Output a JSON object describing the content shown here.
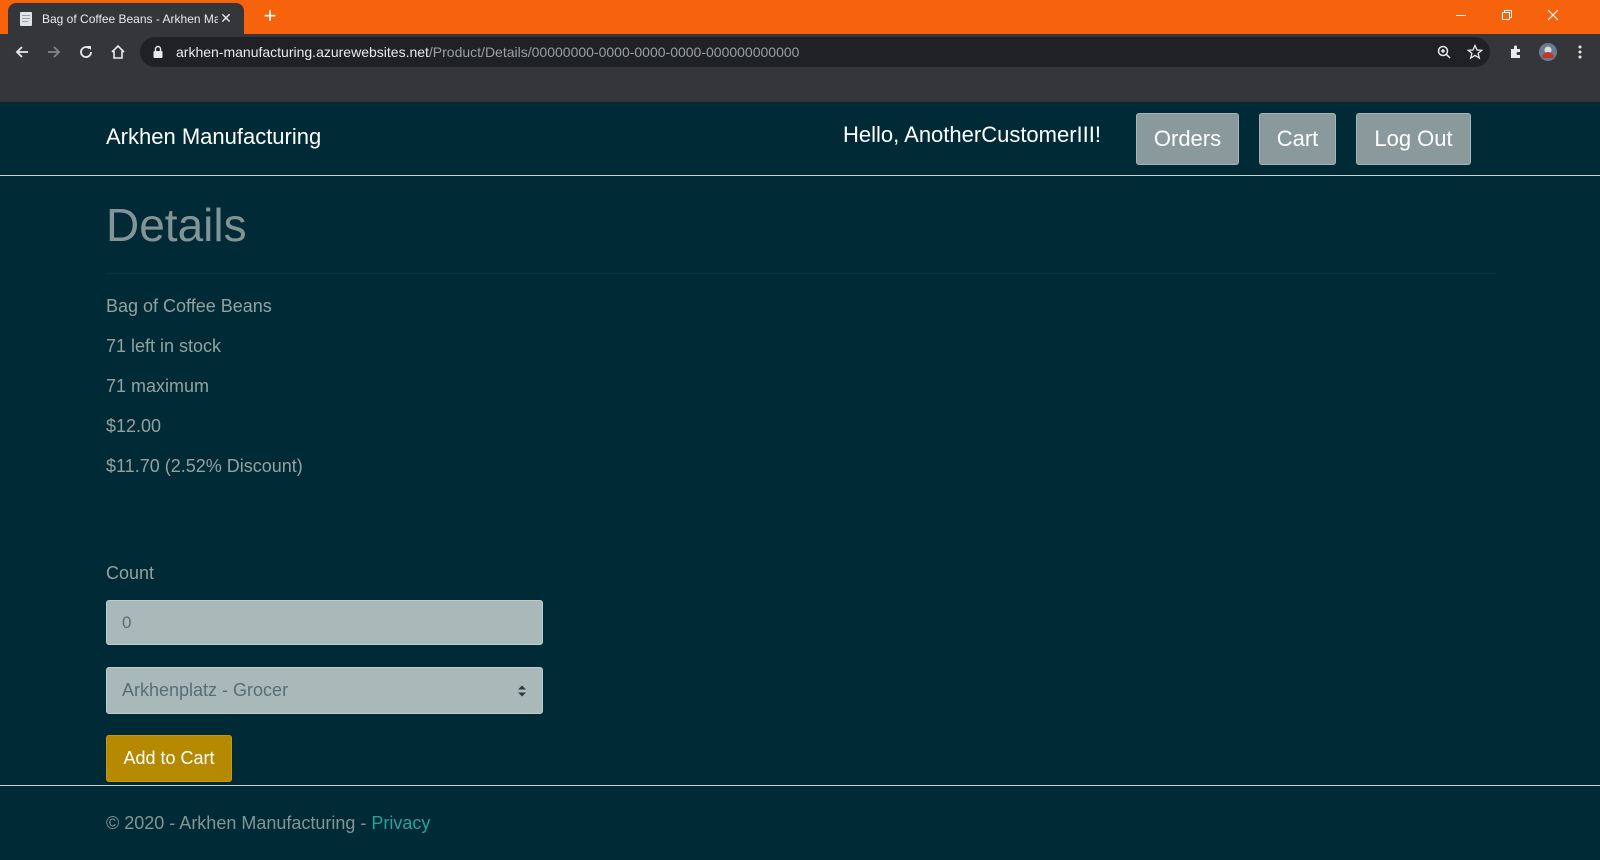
{
  "browser": {
    "tab_title": "Bag of Coffee Beans - Arkhen Ma",
    "url_host": "arkhen-manufacturing.azurewebsites.net",
    "url_path": "/Product/Details/00000000-0000-0000-0000-000000000000",
    "accent_color": "#f7630c"
  },
  "header": {
    "brand": "Arkhen Manufacturing",
    "greeting": "Hello, AnotherCustomerIII!",
    "orders_label": "Orders",
    "cart_label": "Cart",
    "logout_label": "Log Out"
  },
  "main": {
    "title": "Details",
    "product_name": "Bag of Coffee Beans",
    "stock": "71 left in stock",
    "maximum": "71 maximum",
    "price": "$12.00",
    "discounted_price": "$11.70 (2.52% Discount)",
    "count_label": "Count",
    "count_value": "0",
    "location_selected": "Arkhenplatz - Grocer",
    "add_to_cart_label": "Add to Cart"
  },
  "footer": {
    "copyright": "© 2020 - Arkhen Manufacturing - ",
    "privacy_label": "Privacy"
  },
  "colors": {
    "background": "#002b36",
    "primary_button": "#b58900",
    "link": "#2aa198"
  }
}
